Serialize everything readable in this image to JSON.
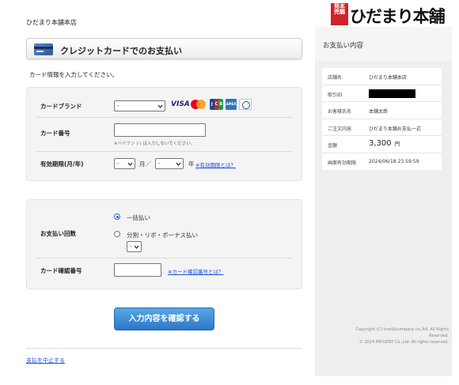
{
  "shop_name": "ひだまり本舗本店",
  "logo": {
    "seal_text": "発本\n売舗",
    "brand_text": "ひだまり本舗"
  },
  "header": {
    "title": "クレジットカードでのお支払い",
    "card_icon": "credit-card-icon"
  },
  "instruction": "カード情報を入力してください。",
  "card_form": {
    "brand_label": "カードブランド",
    "brand_select_value": "-",
    "brands": [
      "VISA",
      "Mastercard",
      "JCB",
      "AMERICAN EXPRESS",
      "Diners Club"
    ],
    "brand_text": {
      "visa": "VISA",
      "jcb": [
        "J",
        "C",
        "B"
      ],
      "amex": "AMEX"
    },
    "number_label": "カード番号",
    "number_value": "",
    "number_hint": "※ハイフン (-) は入力しないでください。",
    "expiry_label": "有効期限(月/年)",
    "expiry_month_value": "-",
    "expiry_month_unit": "月／",
    "expiry_year_value": "-",
    "expiry_year_unit": "年",
    "expiry_help_link": "※有効期限とは？"
  },
  "payment_form": {
    "count_label": "お支払い回数",
    "option_lump": "一括払い",
    "option_installment": "分割・リボ・ボーナス払い",
    "installment_select_value": "-",
    "selected_option": "lump",
    "cvv_label": "カード確認番号",
    "cvv_value": "",
    "cvv_help_link": "※カード確認番号とは？"
  },
  "confirm_button": "入力内容を確認する",
  "cancel_link": "支払を中止する",
  "sidebar": {
    "title": "お支払い内容",
    "rows": [
      {
        "key": "店舗名",
        "value": "ひだまり本舗本店"
      },
      {
        "key": "取引ID",
        "value": ""
      },
      {
        "key": "お客様氏名",
        "value": "本舗太郎"
      },
      {
        "key": "ご注文内容",
        "value": "ひだまり本舗お支払一式"
      },
      {
        "key": "金額",
        "value": "3,300",
        "unit": "円"
      },
      {
        "key": "画面有効期限",
        "value": "2024/06/18 23:59:59"
      }
    ]
  },
  "footer": {
    "line1": "Copyright (C) trust&company co.,ltd. All Rights",
    "line2": "Reserved.",
    "line3": "© 2024 PAYGENT Co.,Ltd. All rights reserved."
  },
  "colors": {
    "accent": "#2a78c8",
    "link": "#1a4fd6",
    "sidebar_bg": "#eeeeee"
  }
}
